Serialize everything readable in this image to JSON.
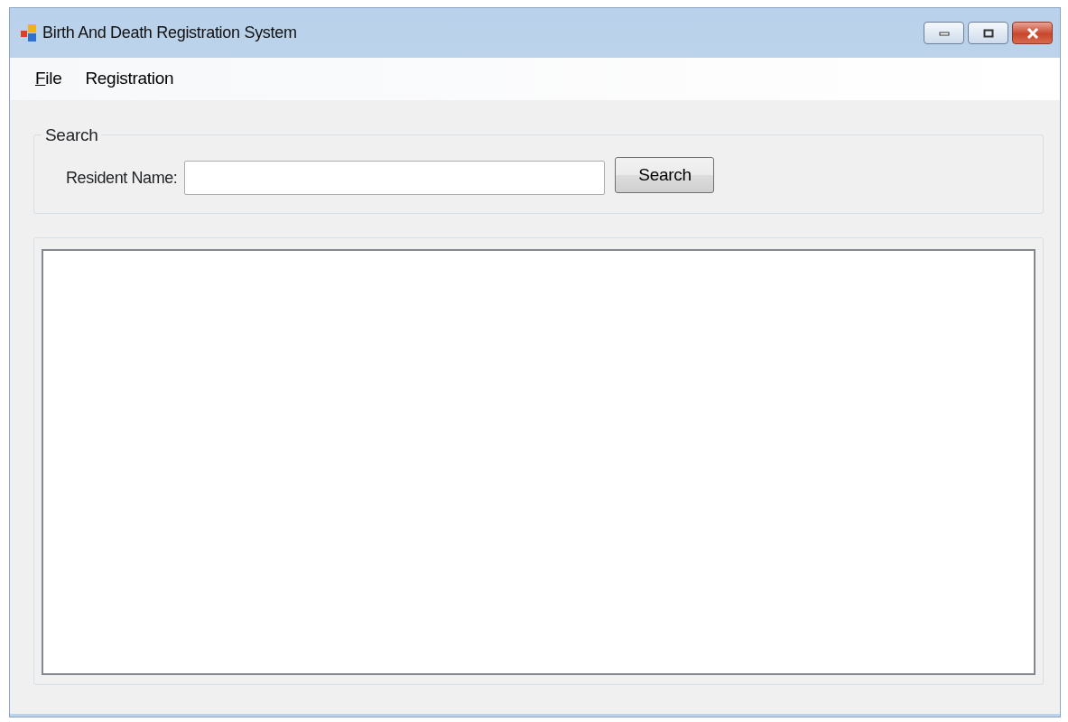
{
  "window": {
    "title": "Birth And Death Registration System"
  },
  "menu": [
    {
      "label": "File",
      "mnemonic": true
    },
    {
      "label": "Registration",
      "mnemonic": false
    }
  ],
  "search_group": {
    "title": "Search",
    "label": "Resident Name:",
    "button": "Search"
  }
}
